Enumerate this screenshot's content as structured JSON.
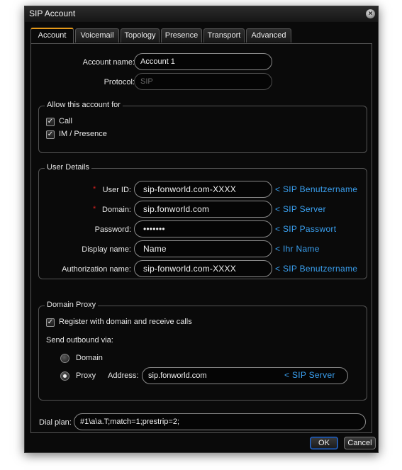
{
  "window": {
    "title": "SIP Account",
    "close_glyph": "×"
  },
  "tabs": [
    "Account",
    "Voicemail",
    "Topology",
    "Presence",
    "Transport",
    "Advanced"
  ],
  "account": {
    "name_label": "Account name:",
    "name_value": "Account 1",
    "protocol_label": "Protocol:",
    "protocol_value": "SIP"
  },
  "allow": {
    "legend": "Allow this account for",
    "call_label": "Call",
    "call_checked": true,
    "im_label": "IM / Presence",
    "im_checked": true
  },
  "user_details": {
    "legend": "User Details",
    "required_mark": "*",
    "user_id_label": "User ID:",
    "user_id_value": "sip-fonworld.com-XXXX",
    "user_id_hint": "< SIP Benutzername",
    "domain_label": "Domain:",
    "domain_value": "sip.fonworld.com",
    "domain_hint": "< SIP Server",
    "password_label": "Password:",
    "password_value": "•••••••",
    "password_hint": "< SIP Passwort",
    "display_label": "Display name:",
    "display_value": "Name",
    "display_hint": "< Ihr Name",
    "auth_label": "Authorization name:",
    "auth_value": "sip-fonworld.com-XXXX",
    "auth_hint": "< SIP Benutzername"
  },
  "proxy": {
    "legend": "Domain Proxy",
    "register_label": "Register with domain and receive calls",
    "register_checked": true,
    "outbound_label": "Send outbound via:",
    "domain_option": "Domain",
    "proxy_option": "Proxy",
    "selected": "Proxy",
    "address_label": "Address:",
    "address_value": "sip.fonworld.com",
    "address_hint": "< SIP Server"
  },
  "dial_plan": {
    "label": "Dial plan:",
    "value": "#1\\a\\a.T;match=1;prestrip=2;"
  },
  "buttons": {
    "ok": "OK",
    "cancel": "Cancel"
  },
  "check_glyph": "✓",
  "colors": {
    "accent_tab": "#e69a1a",
    "hint_blue": "#3aa0f0",
    "required_red": "#d02020",
    "ok_border": "#2f6fd0"
  }
}
